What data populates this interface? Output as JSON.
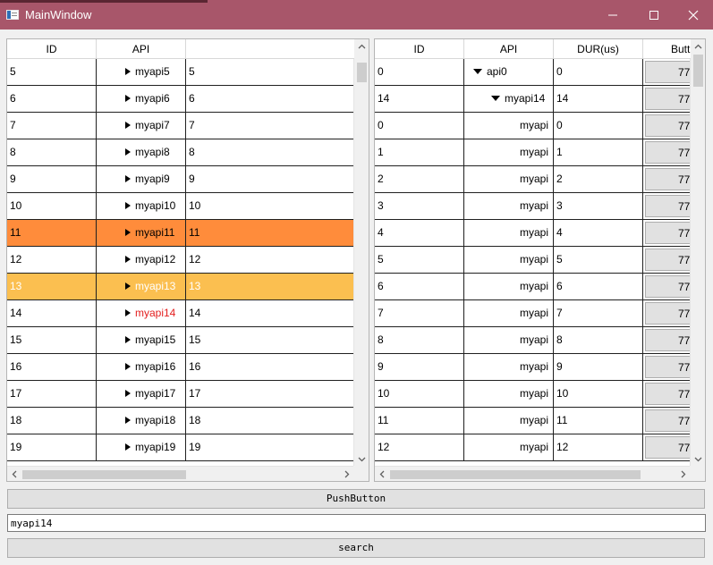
{
  "window": {
    "title": "MainWindow",
    "accent_color": "#a8566a"
  },
  "left_table": {
    "headers": [
      "ID",
      "API",
      ""
    ],
    "rows": [
      {
        "id": "5",
        "api": "myapi5",
        "dur": "5",
        "state": "normal"
      },
      {
        "id": "6",
        "api": "myapi6",
        "dur": "6",
        "state": "normal"
      },
      {
        "id": "7",
        "api": "myapi7",
        "dur": "7",
        "state": "normal"
      },
      {
        "id": "8",
        "api": "myapi8",
        "dur": "8",
        "state": "normal"
      },
      {
        "id": "9",
        "api": "myapi9",
        "dur": "9",
        "state": "normal"
      },
      {
        "id": "10",
        "api": "myapi10",
        "dur": "10",
        "state": "normal"
      },
      {
        "id": "11",
        "api": "myapi11",
        "dur": "11",
        "state": "highlight-orange"
      },
      {
        "id": "12",
        "api": "myapi12",
        "dur": "12",
        "state": "normal"
      },
      {
        "id": "13",
        "api": "myapi13",
        "dur": "13",
        "state": "highlight-yellow"
      },
      {
        "id": "14",
        "api": "myapi14",
        "dur": "14",
        "state": "match-red"
      },
      {
        "id": "15",
        "api": "myapi15",
        "dur": "15",
        "state": "normal"
      },
      {
        "id": "16",
        "api": "myapi16",
        "dur": "16",
        "state": "normal"
      },
      {
        "id": "17",
        "api": "myapi17",
        "dur": "17",
        "state": "normal"
      },
      {
        "id": "18",
        "api": "myapi18",
        "dur": "18",
        "state": "normal"
      },
      {
        "id": "19",
        "api": "myapi19",
        "dur": "19",
        "state": "normal"
      }
    ],
    "highlight_colors": {
      "orange": "#ff8c3b",
      "yellow": "#fbbf50",
      "match_text": "#e31e1e"
    }
  },
  "right_table": {
    "headers": [
      "ID",
      "API",
      "DUR(us)",
      "Butt"
    ],
    "rows": [
      {
        "id": "0",
        "api": "api0",
        "dur": "0",
        "button": "77",
        "level": 0,
        "expanded": true
      },
      {
        "id": "14",
        "api": "myapi14",
        "dur": "14",
        "button": "77",
        "level": 1,
        "expanded": true
      },
      {
        "id": "0",
        "api": "myapi",
        "dur": "0",
        "button": "77",
        "level": 2
      },
      {
        "id": "1",
        "api": "myapi",
        "dur": "1",
        "button": "77",
        "level": 2
      },
      {
        "id": "2",
        "api": "myapi",
        "dur": "2",
        "button": "77",
        "level": 2
      },
      {
        "id": "3",
        "api": "myapi",
        "dur": "3",
        "button": "77",
        "level": 2
      },
      {
        "id": "4",
        "api": "myapi",
        "dur": "4",
        "button": "77",
        "level": 2
      },
      {
        "id": "5",
        "api": "myapi",
        "dur": "5",
        "button": "77",
        "level": 2
      },
      {
        "id": "6",
        "api": "myapi",
        "dur": "6",
        "button": "77",
        "level": 2
      },
      {
        "id": "7",
        "api": "myapi",
        "dur": "7",
        "button": "77",
        "level": 2
      },
      {
        "id": "8",
        "api": "myapi",
        "dur": "8",
        "button": "77",
        "level": 2
      },
      {
        "id": "9",
        "api": "myapi",
        "dur": "9",
        "button": "77",
        "level": 2
      },
      {
        "id": "10",
        "api": "myapi",
        "dur": "10",
        "button": "77",
        "level": 2
      },
      {
        "id": "11",
        "api": "myapi",
        "dur": "11",
        "button": "77",
        "level": 2
      },
      {
        "id": "12",
        "api": "myapi",
        "dur": "12",
        "button": "77",
        "level": 2
      }
    ]
  },
  "controls": {
    "push_button_label": "PushButton",
    "search_value": "myapi14",
    "search_button_label": "search"
  }
}
